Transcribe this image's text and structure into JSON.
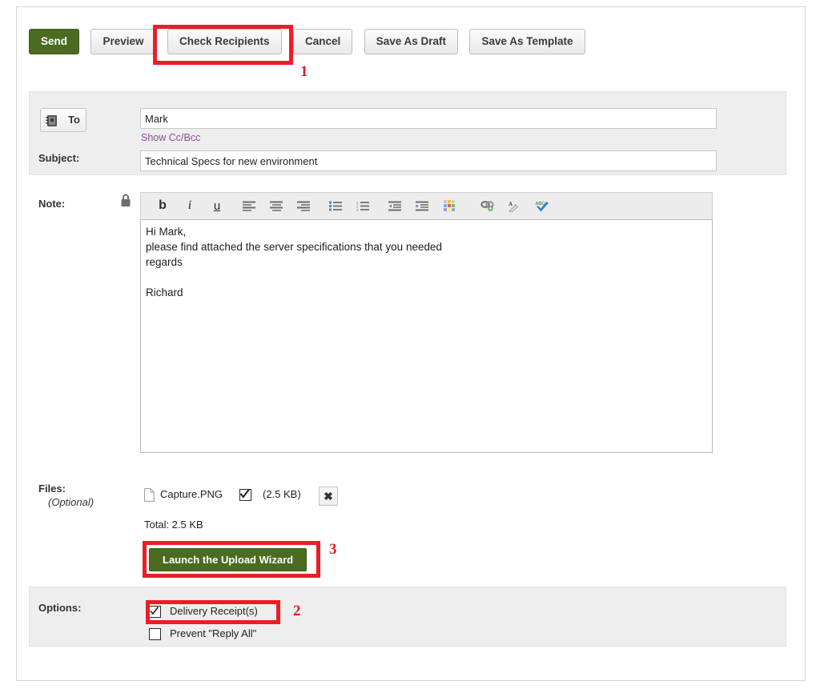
{
  "toolbar": {
    "buttons": [
      {
        "label": "Send",
        "style": "primary",
        "name": "send-button"
      },
      {
        "label": "Preview",
        "style": "default",
        "name": "preview-button"
      },
      {
        "label": "Check Recipients",
        "style": "default",
        "name": "check-recipients-button"
      },
      {
        "label": "Cancel",
        "style": "default",
        "name": "cancel-button"
      },
      {
        "label": "Save As Draft",
        "style": "default",
        "name": "save-as-draft-button"
      },
      {
        "label": "Save As Template",
        "style": "default",
        "name": "save-as-template-button"
      }
    ]
  },
  "compose": {
    "to_button_label": "To",
    "to_icon": "address-book-icon",
    "to_value": "Mark",
    "to_placeholder": "",
    "show_cc_bcc_link": "Show Cc/Bcc",
    "subject_label": "Subject:",
    "subject_value": "Technical Specs for new environment",
    "subject_placeholder": ""
  },
  "note": {
    "label": "Note:",
    "lock_icon": "lock-icon",
    "body_text": "Hi Mark,\nplease find attached the server specifications that you needed\nregards\n\nRichard",
    "editor_tools": [
      {
        "name": "bold-icon",
        "glyph": "b",
        "style": "bold"
      },
      {
        "name": "italic-icon",
        "glyph": "i",
        "style": "italic"
      },
      {
        "name": "underline-icon",
        "glyph": "u",
        "style": "underline"
      },
      {
        "name": "align-left-icon",
        "glyph": "align-left"
      },
      {
        "name": "align-center-icon",
        "glyph": "align-center"
      },
      {
        "name": "align-right-icon",
        "glyph": "align-right"
      },
      {
        "name": "bullet-list-icon",
        "glyph": "bullet-list"
      },
      {
        "name": "numbered-list-icon",
        "glyph": "numbered-list"
      },
      {
        "name": "outdent-icon",
        "glyph": "outdent"
      },
      {
        "name": "indent-icon",
        "glyph": "indent"
      },
      {
        "name": "color-palette-icon",
        "glyph": "palette"
      },
      {
        "name": "insert-link-icon",
        "glyph": "link"
      },
      {
        "name": "font-style-icon",
        "glyph": "font"
      },
      {
        "name": "spellcheck-icon",
        "glyph": "spellcheck"
      }
    ]
  },
  "files": {
    "label": "Files:",
    "optional_label": "(Optional)",
    "attachments": [
      {
        "icon": "file-icon",
        "name": "Capture.PNG",
        "checked": true,
        "size": "(2.5 KB)",
        "delete_icon": "close-icon"
      }
    ],
    "total_label": "Total: 2.5 KB",
    "upload_button_label": "Launch the Upload Wizard"
  },
  "options": {
    "label": "Options:",
    "items": [
      {
        "label": "Delivery Receipt(s)",
        "checked": true
      },
      {
        "label": "Prevent \"Reply All\"",
        "checked": false
      }
    ]
  },
  "annotations": [
    {
      "number": "1",
      "target": "check-recipients-button"
    },
    {
      "number": "2",
      "target": "delivery-receipts-checkbox"
    },
    {
      "number": "3",
      "target": "launch-upload-wizard-button"
    }
  ],
  "colors": {
    "primary_green": "#4b6b22",
    "annotation_red": "#ee1c25",
    "link_purple": "#8e4a9e",
    "panel_gray": "#eeeeee"
  }
}
